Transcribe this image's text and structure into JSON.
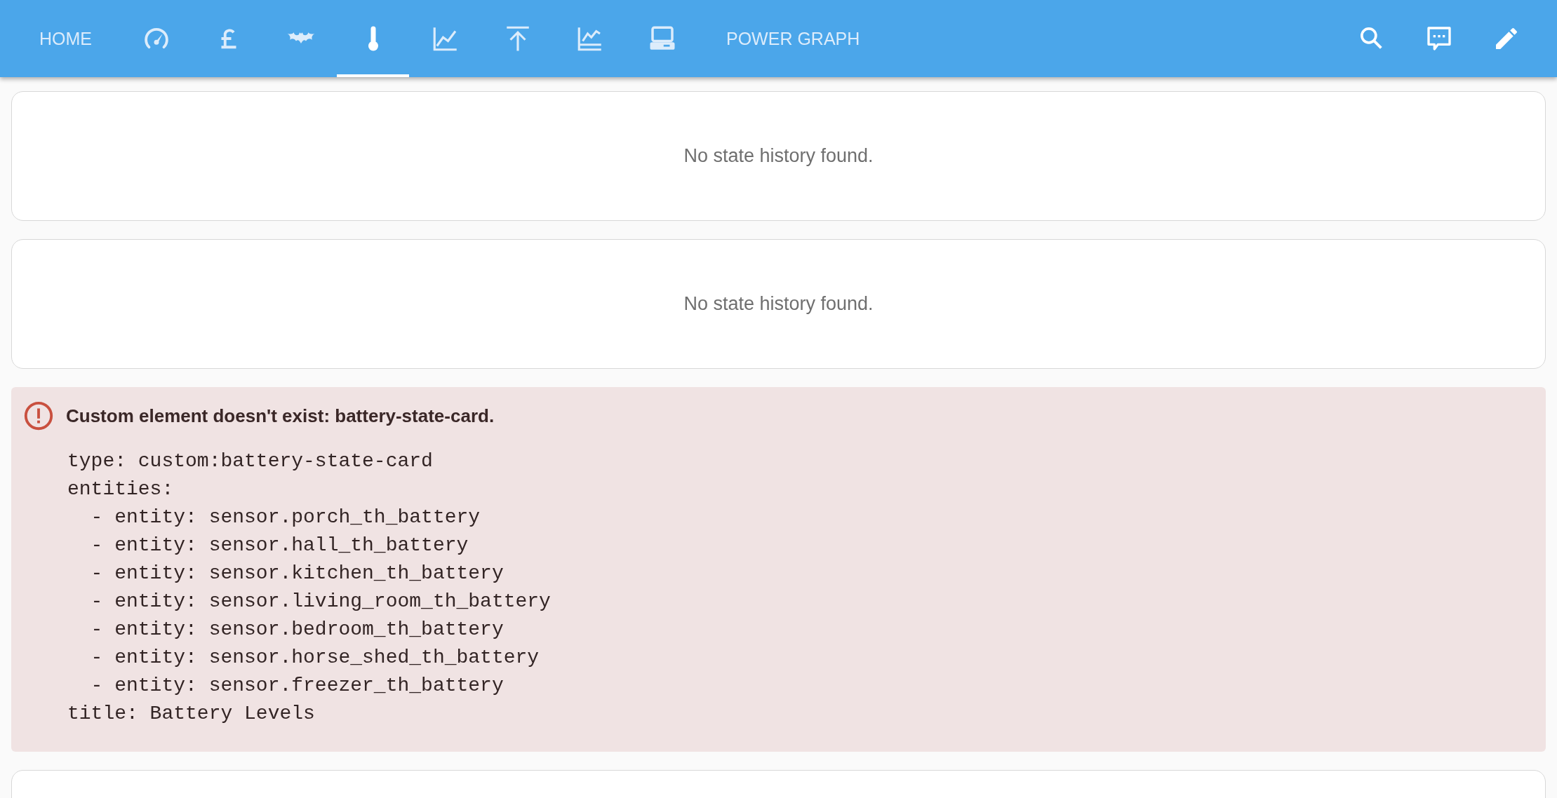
{
  "toolbar": {
    "tabs": [
      {
        "kind": "text",
        "label": "HOME",
        "selected": false
      },
      {
        "kind": "gauge",
        "selected": false
      },
      {
        "kind": "pound",
        "selected": false
      },
      {
        "kind": "bat",
        "selected": false
      },
      {
        "kind": "thermometer",
        "selected": true
      },
      {
        "kind": "linechart",
        "selected": false
      },
      {
        "kind": "uparrow",
        "selected": false
      },
      {
        "kind": "areachart",
        "selected": false
      },
      {
        "kind": "computer",
        "selected": false
      },
      {
        "kind": "text",
        "label": "POWER GRAPH",
        "selected": false
      }
    ],
    "actions": [
      {
        "kind": "search"
      },
      {
        "kind": "comment"
      },
      {
        "kind": "edit"
      }
    ]
  },
  "cards": [
    {
      "kind": "history",
      "message": "No state history found."
    },
    {
      "kind": "history",
      "message": "No state history found."
    },
    {
      "kind": "error",
      "title": "Custom element doesn't exist: battery-state-card.",
      "code": [
        "type: custom:battery-state-card",
        "entities:",
        "  - entity: sensor.porch_th_battery",
        "  - entity: sensor.hall_th_battery",
        "  - entity: sensor.kitchen_th_battery",
        "  - entity: sensor.living_room_th_battery",
        "  - entity: sensor.bedroom_th_battery",
        "  - entity: sensor.horse_shed_th_battery",
        "  - entity: sensor.freezer_th_battery",
        "title: Battery Levels"
      ]
    },
    {
      "kind": "empty"
    }
  ]
}
